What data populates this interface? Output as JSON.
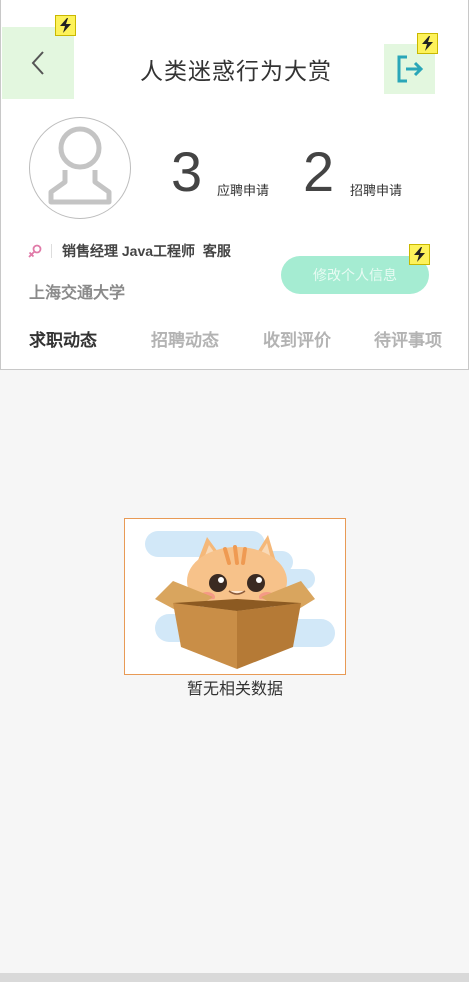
{
  "header": {
    "title": "人类迷惑行为大赏",
    "back_icon": "chevron-left-icon",
    "logout_icon": "logout-icon"
  },
  "profile": {
    "avatar_icon": "user-avatar-icon",
    "gender_icon": "female-icon",
    "tags": "销售经理 Java工程师  客服",
    "school": "上海交通大学",
    "edit_button": "修改个人信息",
    "stats": [
      {
        "value": "3",
        "label": "应聘申请"
      },
      {
        "value": "2",
        "label": "招聘申请"
      }
    ]
  },
  "tabs": [
    {
      "label": "求职动态",
      "active": true
    },
    {
      "label": "招聘动态",
      "active": false
    },
    {
      "label": "收到评价",
      "active": false
    },
    {
      "label": "待评事项",
      "active": false
    }
  ],
  "empty_state": {
    "illustration": "cat-in-box-illustration",
    "text": "暂无相关数据"
  },
  "colors": {
    "accent_green": "#a5ecd2",
    "badge_yellow": "#fdf25a",
    "logout_icon": "#2aa6b8"
  }
}
